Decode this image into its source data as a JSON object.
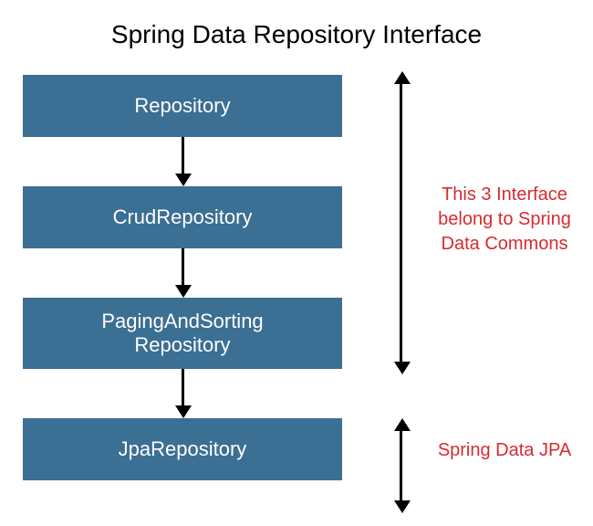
{
  "title": "Spring Data Repository Interface",
  "boxes": {
    "repository": "Repository",
    "crud": "CrudRepository",
    "paging_line1": "PagingAndSorting",
    "paging_line2": "Repository",
    "jpa": "JpaRepository"
  },
  "annotations": {
    "commons_line1": "This 3 Interface",
    "commons_line2": "belong to Spring",
    "commons_line3": "Data Commons",
    "jpa": "Spring Data JPA"
  }
}
